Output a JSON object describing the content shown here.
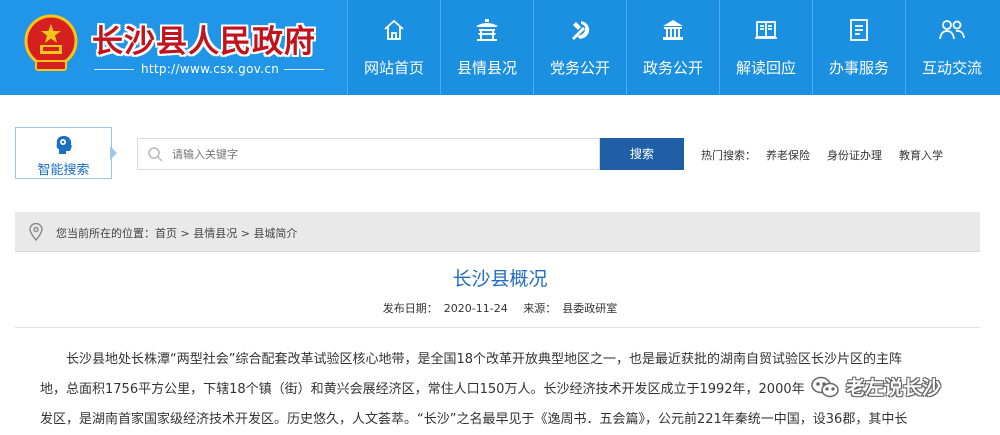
{
  "header": {
    "site_title": "长沙县人民政府",
    "site_url": "http://www.csx.gov.cn",
    "nav": [
      {
        "label": "网站首页",
        "icon": "home-icon"
      },
      {
        "label": "县情县况",
        "icon": "pavilion-icon"
      },
      {
        "label": "党务公开",
        "icon": "party-emblem-icon"
      },
      {
        "label": "政务公开",
        "icon": "government-building-icon"
      },
      {
        "label": "解读回应",
        "icon": "open-book-icon"
      },
      {
        "label": "办事服务",
        "icon": "document-icon"
      },
      {
        "label": "互动交流",
        "icon": "people-icon"
      }
    ],
    "colors": {
      "bar": "#1b8fe0",
      "title_red": "#c2121b"
    }
  },
  "search": {
    "smart_label": "智能搜索",
    "placeholder": "请输入关键字",
    "button_label": "搜索",
    "hot_label": "热门搜索：",
    "hot_items": [
      "养老保险",
      "身份证办理",
      "教育入学"
    ]
  },
  "breadcrumb": {
    "prefix": "您当前所在的位置：",
    "items": [
      "首页",
      "县情县况",
      "县城简介"
    ],
    "separator": " > "
  },
  "article": {
    "title": "长沙县概况",
    "date_label": "发布日期：",
    "date": "2020-11-24",
    "source_label": "来源：",
    "source": "县委政研室",
    "lines": [
      "长沙县地处长株潭“两型社会”综合配套改革试验区核心地带，是全国18个改革开放典型地区之一，也是最近获批的湖南自贸试验区长沙片区的主阵",
      "地，总面积1756平方公里，下辖18个镇（街）和黄兴会展经济区，常住人口150万人。长沙经济技术开发区成立于1992年，2000年",
      "发区，是湖南首家国家级经济技术开发区。历史悠久，人文荟萃。“长沙”之名最早见于《逸周书．五会篇》，公元前221年秦统一中国，设36郡，其中长"
    ]
  },
  "watermark": {
    "text": "老左说长沙"
  }
}
